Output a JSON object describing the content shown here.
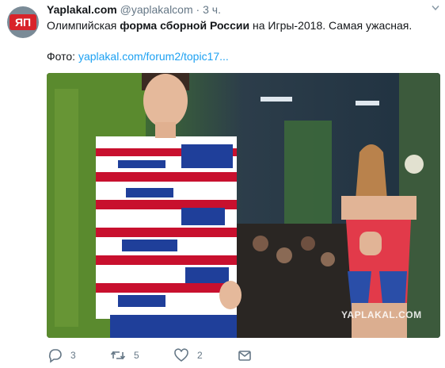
{
  "tweet": {
    "author_name": "Yaplakal.com",
    "author_handle": "@yaplakalcom",
    "separator": "·",
    "time": "3 ч.",
    "text_before": "Олимпийская ",
    "text_bold": "форма сборной России",
    "text_after": " на Игры-2018. Самая ужасная.",
    "photo_label": "Фото: ",
    "photo_link": "yaplakal.com/forum2/topic17..."
  },
  "avatar": {
    "logo_text": "ЯП"
  },
  "image": {
    "watermark": "YAPLAKAL.COM"
  },
  "actions": {
    "replies": "3",
    "retweets": "5",
    "likes": "2"
  },
  "colors": {
    "link": "#1da1f2",
    "muted": "#657786",
    "text": "#14171a",
    "avatar_bg": "#7a8b97",
    "logo_red": "#d8232a"
  }
}
